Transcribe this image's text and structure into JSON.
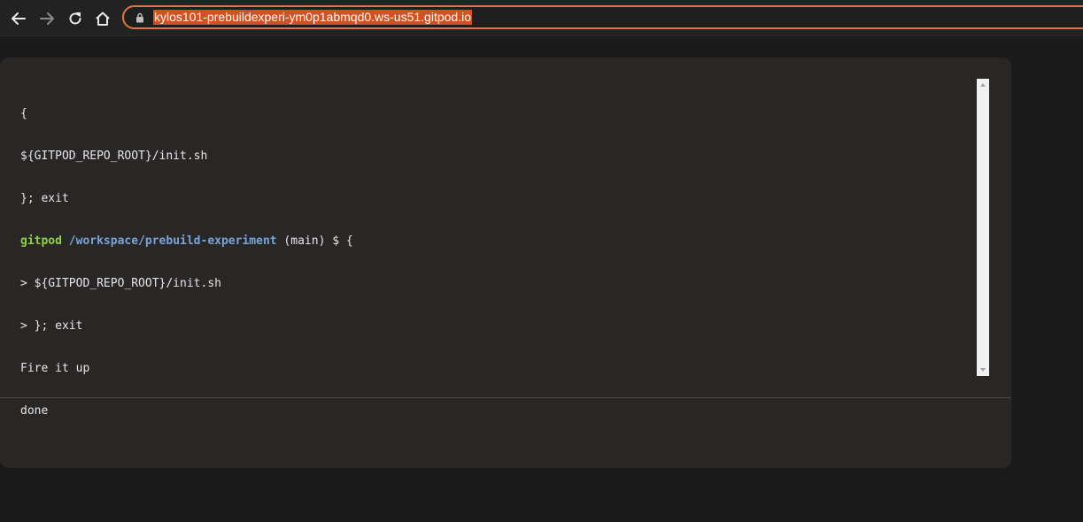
{
  "browser": {
    "url": "kylos101-prebuildexperi-ym0p1abmqd0.ws-us51.gitpod.io",
    "icons": {
      "back": "arrow-left-icon",
      "forward": "arrow-right-icon",
      "reload": "reload-icon",
      "home": "home-icon",
      "lock": "lock-icon"
    }
  },
  "terminal": {
    "lines": [
      "{",
      "${GITPOD_REPO_ROOT}/init.sh",
      "}; exit"
    ],
    "prompt": {
      "user": "gitpod",
      "path": "/workspace/prebuild-experiment",
      "rest": " (main) $ {"
    },
    "output": [
      "> ${GITPOD_REPO_ROOT}/init.sh",
      "> }; exit",
      "Fire it up",
      "done"
    ]
  },
  "colors": {
    "accent": "#e2753d",
    "url_highlight": "#d5501f",
    "prompt_user": "#8ed144",
    "prompt_path": "#7aa4d8",
    "panel_bg": "#292626",
    "page_bg": "#1b1a1a"
  }
}
